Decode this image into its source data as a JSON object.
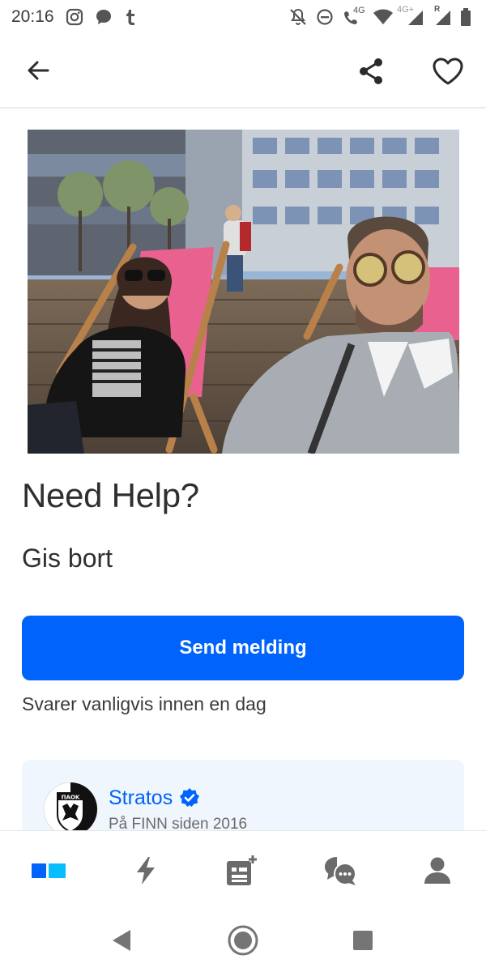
{
  "status_bar": {
    "time": "20:16",
    "network_label": "4G",
    "network_label_2": "4G+",
    "roaming_label": "R",
    "icons": [
      "instagram-icon",
      "chat-bubble-icon",
      "tumblr-icon",
      "bell-off-icon",
      "do-not-disturb-icon",
      "wifi-calling-icon",
      "wifi-icon",
      "signal-icon",
      "signal-roaming-icon",
      "battery-icon"
    ]
  },
  "top_bar": {
    "icons": [
      "back-arrow-icon",
      "share-icon",
      "heart-icon"
    ]
  },
  "listing": {
    "title": "Need Help?",
    "price": "Gis bort",
    "send_button_label": "Send melding",
    "reply_info": "Svarer vanligvis innen en dag"
  },
  "seller": {
    "name": "Stratos",
    "since": "På FINN siden 2016",
    "avatar_text": "ΠΑΟΚ"
  },
  "bottom_nav": {
    "items": [
      "home-icon",
      "lightning-icon",
      "new-ad-icon",
      "messages-icon",
      "profile-icon"
    ]
  },
  "colors": {
    "accent": "#0063fb",
    "card_background": "#f0f6fd",
    "text": "#2f2f2f"
  }
}
